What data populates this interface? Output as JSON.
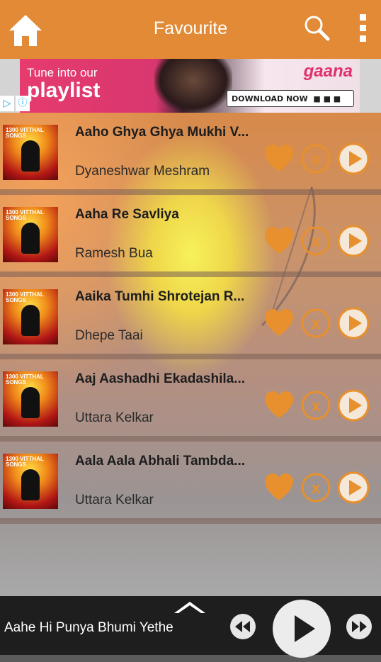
{
  "header": {
    "title": "Favourite",
    "icons": [
      "home-icon",
      "search-icon",
      "more-vertical-icon"
    ],
    "accent_color": "#e28a35"
  },
  "ad": {
    "tagline": "Tune into our",
    "headline": "playlist",
    "brand": "gaana",
    "cta": "DOWNLOAD NOW",
    "close_icon": "close-icon",
    "info_icon": "info-icon"
  },
  "songs": [
    {
      "title": "Aaho Ghya Ghya Mukhi V...",
      "artist": "Dyaneshwar Meshram",
      "thumb_text": "1300 VITTHAL SONGS"
    },
    {
      "title": "Aaha Re Savliya",
      "artist": "Ramesh Bua",
      "thumb_text": "1300 VITTHAL SONGS"
    },
    {
      "title": "Aaika Tumhi Shrotejan R...",
      "artist": "Dhepe Taai",
      "thumb_text": "1300 VITTHAL SONGS"
    },
    {
      "title": "Aaj Aashadhi Ekadashila...",
      "artist": "Uttara Kelkar",
      "thumb_text": "1300 VITTHAL SONGS"
    },
    {
      "title": "Aala Aala Abhali Tambda...",
      "artist": "Uttara Kelkar",
      "thumb_text": "1300 VITTHAL SONGS"
    }
  ],
  "row_icons": [
    "heart-icon",
    "remove-circle-icon",
    "play-circle-icon"
  ],
  "player": {
    "now_playing": "Aahe Hi Punya Bhumi Yethe",
    "icons": [
      "chevron-up-icon",
      "rewind-icon",
      "play-icon",
      "fast-forward-icon"
    ]
  }
}
